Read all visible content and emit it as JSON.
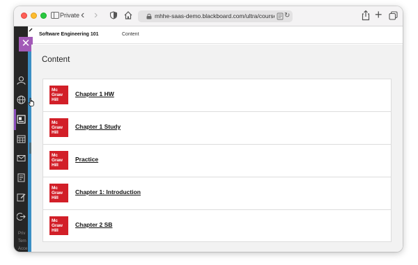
{
  "browser": {
    "private_label": "Private",
    "url": "mhhe-saas-demo.blackboard.com/ultra/courses/_9431",
    "icons": [
      "sidebar-icon",
      "back-icon",
      "forward-icon",
      "shield-icon",
      "home-icon",
      "lock-icon",
      "reader-icon",
      "reload-icon",
      "share-icon",
      "new-tab-icon",
      "tabs-overview-icon"
    ]
  },
  "bb_nav": {
    "icons": [
      "profile-icon",
      "globe-icon",
      "courses-icon",
      "calendar-icon",
      "messages-icon",
      "grades-icon",
      "edit-icon",
      "signout-icon"
    ],
    "footer": [
      "Priv",
      "Tern",
      "Acce"
    ]
  },
  "course": {
    "title": "Software Engineering 101",
    "tab": "Content",
    "close_symbol": "✕",
    "collapse_symbol": "›"
  },
  "content": {
    "heading": "Content",
    "publisher_logo": [
      "Mc",
      "Graw",
      "Hill"
    ],
    "items": [
      {
        "title": "Chapter 1 HW"
      },
      {
        "title": "Chapter 1 Study"
      },
      {
        "title": "Practice"
      },
      {
        "title": "Chapter 1: Introduction"
      },
      {
        "title": "Chapter 2 SB"
      }
    ]
  },
  "colors": {
    "accent_purple": "#a25ab7",
    "strip_blue": "#3c8fc4",
    "logo_red": "#d21f28",
    "nav_dark": "#262626"
  }
}
